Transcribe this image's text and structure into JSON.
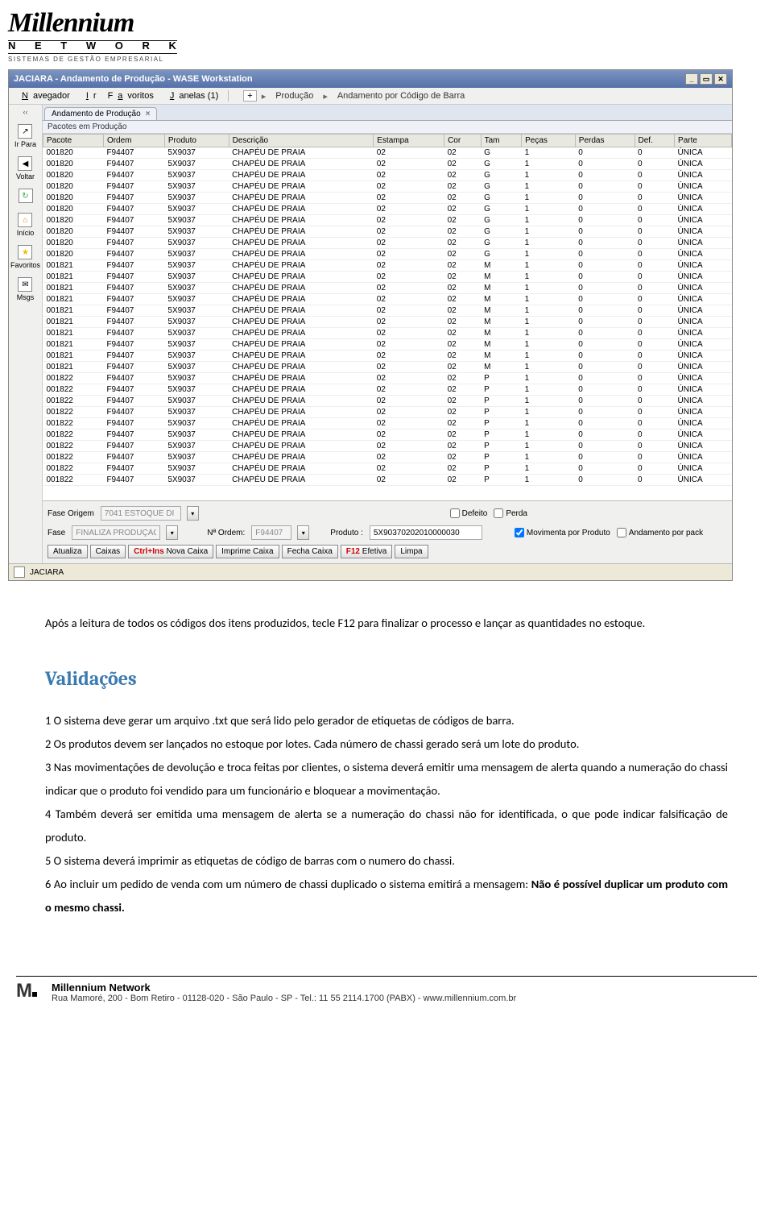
{
  "logo": {
    "main": "Millennium",
    "sub": "N E T W O R K",
    "tag": "SISTEMAS DE GESTÃO EMPRESARIAL"
  },
  "window": {
    "title": "JACIARA - Andamento de Produção - WASE Workstation"
  },
  "menubar": {
    "navegador": "Navegador",
    "ir": "Ir",
    "favoritos": "Favoritos",
    "janelas": "Janelas (1)",
    "plus": "+",
    "crumb1": "Produção",
    "crumb2": "Andamento por Código de Barra"
  },
  "sidebar": {
    "back_arrows": "‹‹",
    "irpara": "Ir Para",
    "voltar": "Voltar",
    "inicio": "Início",
    "favoritos": "Favoritos",
    "msgs": "Msgs"
  },
  "tab": {
    "label": "Andamento de Produção",
    "section": "Pacotes em Produção"
  },
  "columns": [
    "Pacote",
    "Ordem",
    "Produto",
    "Descrição",
    "Estampa",
    "Cor",
    "Tam",
    "Peças",
    "Perdas",
    "Def.",
    "Parte"
  ],
  "rows": [
    [
      "001820",
      "F94407",
      "5X9037",
      "CHAPÉU DE PRAIA",
      "02",
      "02",
      "G",
      "1",
      "0",
      "0",
      "ÚNICA"
    ],
    [
      "001820",
      "F94407",
      "5X9037",
      "CHAPÉU DE PRAIA",
      "02",
      "02",
      "G",
      "1",
      "0",
      "0",
      "ÚNICA"
    ],
    [
      "001820",
      "F94407",
      "5X9037",
      "CHAPÉU DE PRAIA",
      "02",
      "02",
      "G",
      "1",
      "0",
      "0",
      "ÚNICA"
    ],
    [
      "001820",
      "F94407",
      "5X9037",
      "CHAPÉU DE PRAIA",
      "02",
      "02",
      "G",
      "1",
      "0",
      "0",
      "ÚNICA"
    ],
    [
      "001820",
      "F94407",
      "5X9037",
      "CHAPÉU DE PRAIA",
      "02",
      "02",
      "G",
      "1",
      "0",
      "0",
      "ÚNICA"
    ],
    [
      "001820",
      "F94407",
      "5X9037",
      "CHAPÉU DE PRAIA",
      "02",
      "02",
      "G",
      "1",
      "0",
      "0",
      "ÚNICA"
    ],
    [
      "001820",
      "F94407",
      "5X9037",
      "CHAPÉU DE PRAIA",
      "02",
      "02",
      "G",
      "1",
      "0",
      "0",
      "ÚNICA"
    ],
    [
      "001820",
      "F94407",
      "5X9037",
      "CHAPÉU DE PRAIA",
      "02",
      "02",
      "G",
      "1",
      "0",
      "0",
      "ÚNICA"
    ],
    [
      "001820",
      "F94407",
      "5X9037",
      "CHAPÉU DE PRAIA",
      "02",
      "02",
      "G",
      "1",
      "0",
      "0",
      "ÚNICA"
    ],
    [
      "001820",
      "F94407",
      "5X9037",
      "CHAPÉU DE PRAIA",
      "02",
      "02",
      "G",
      "1",
      "0",
      "0",
      "ÚNICA"
    ],
    [
      "001821",
      "F94407",
      "5X9037",
      "CHAPÉU DE PRAIA",
      "02",
      "02",
      "M",
      "1",
      "0",
      "0",
      "ÚNICA"
    ],
    [
      "001821",
      "F94407",
      "5X9037",
      "CHAPÉU DE PRAIA",
      "02",
      "02",
      "M",
      "1",
      "0",
      "0",
      "ÚNICA"
    ],
    [
      "001821",
      "F94407",
      "5X9037",
      "CHAPÉU DE PRAIA",
      "02",
      "02",
      "M",
      "1",
      "0",
      "0",
      "ÚNICA"
    ],
    [
      "001821",
      "F94407",
      "5X9037",
      "CHAPÉU DE PRAIA",
      "02",
      "02",
      "M",
      "1",
      "0",
      "0",
      "ÚNICA"
    ],
    [
      "001821",
      "F94407",
      "5X9037",
      "CHAPÉU DE PRAIA",
      "02",
      "02",
      "M",
      "1",
      "0",
      "0",
      "ÚNICA"
    ],
    [
      "001821",
      "F94407",
      "5X9037",
      "CHAPÉU DE PRAIA",
      "02",
      "02",
      "M",
      "1",
      "0",
      "0",
      "ÚNICA"
    ],
    [
      "001821",
      "F94407",
      "5X9037",
      "CHAPÉU DE PRAIA",
      "02",
      "02",
      "M",
      "1",
      "0",
      "0",
      "ÚNICA"
    ],
    [
      "001821",
      "F94407",
      "5X9037",
      "CHAPÉU DE PRAIA",
      "02",
      "02",
      "M",
      "1",
      "0",
      "0",
      "ÚNICA"
    ],
    [
      "001821",
      "F94407",
      "5X9037",
      "CHAPÉU DE PRAIA",
      "02",
      "02",
      "M",
      "1",
      "0",
      "0",
      "ÚNICA"
    ],
    [
      "001821",
      "F94407",
      "5X9037",
      "CHAPÉU DE PRAIA",
      "02",
      "02",
      "M",
      "1",
      "0",
      "0",
      "ÚNICA"
    ],
    [
      "001822",
      "F94407",
      "5X9037",
      "CHAPÉU DE PRAIA",
      "02",
      "02",
      "P",
      "1",
      "0",
      "0",
      "ÚNICA"
    ],
    [
      "001822",
      "F94407",
      "5X9037",
      "CHAPÉU DE PRAIA",
      "02",
      "02",
      "P",
      "1",
      "0",
      "0",
      "ÚNICA"
    ],
    [
      "001822",
      "F94407",
      "5X9037",
      "CHAPÉU DE PRAIA",
      "02",
      "02",
      "P",
      "1",
      "0",
      "0",
      "ÚNICA"
    ],
    [
      "001822",
      "F94407",
      "5X9037",
      "CHAPÉU DE PRAIA",
      "02",
      "02",
      "P",
      "1",
      "0",
      "0",
      "ÚNICA"
    ],
    [
      "001822",
      "F94407",
      "5X9037",
      "CHAPÉU DE PRAIA",
      "02",
      "02",
      "P",
      "1",
      "0",
      "0",
      "ÚNICA"
    ],
    [
      "001822",
      "F94407",
      "5X9037",
      "CHAPÉU DE PRAIA",
      "02",
      "02",
      "P",
      "1",
      "0",
      "0",
      "ÚNICA"
    ],
    [
      "001822",
      "F94407",
      "5X9037",
      "CHAPÉU DE PRAIA",
      "02",
      "02",
      "P",
      "1",
      "0",
      "0",
      "ÚNICA"
    ],
    [
      "001822",
      "F94407",
      "5X9037",
      "CHAPÉU DE PRAIA",
      "02",
      "02",
      "P",
      "1",
      "0",
      "0",
      "ÚNICA"
    ],
    [
      "001822",
      "F94407",
      "5X9037",
      "CHAPÉU DE PRAIA",
      "02",
      "02",
      "P",
      "1",
      "0",
      "0",
      "ÚNICA"
    ],
    [
      "001822",
      "F94407",
      "5X9037",
      "CHAPÉU DE PRAIA",
      "02",
      "02",
      "P",
      "1",
      "0",
      "0",
      "ÚNICA"
    ]
  ],
  "form": {
    "fase_origem_label": "Fase Origem",
    "fase_origem_value": "7041 ESTOQUE DI",
    "defeito": "Defeito",
    "perda": "Perda",
    "fase_label": "Fase",
    "fase_value": "FINALIZA PRODUÇÃO",
    "ordem_label": "Nª Ordem:",
    "ordem_value": "F94407",
    "produto_label": "Produto :",
    "produto_value": "5X90370202010000030",
    "movimenta": "Movimenta por Produto",
    "andamento_pack": "Andamento por pack"
  },
  "actions": {
    "atualiza": "Atualiza",
    "caixas": "Caixas",
    "ctrlins": "Ctrl+Ins",
    "novacaixa": "Nova Caixa",
    "imprime": "Imprime Caixa",
    "fecha": "Fecha Caixa",
    "f12": "F12",
    "efetiva": "Efetiva",
    "limpa": "Limpa"
  },
  "status": {
    "text": "JACIARA"
  },
  "doc": {
    "p1": "Após a leitura de todos os códigos dos itens produzidos, tecle F12 para finalizar o processo e lançar as quantidades no estoque.",
    "heading": "Validações",
    "p2": "1 O sistema deve gerar um arquivo .txt que será lido pelo gerador de etiquetas de códigos de barra.",
    "p3": "2 Os produtos devem ser lançados no estoque por lotes. Cada número de chassi gerado será um lote do produto.",
    "p4": "3 Nas movimentações de devolução e troca feitas por clientes, o sistema deverá emitir uma mensagem de alerta quando a numeração do chassi indicar que o produto foi vendido para um funcionário e bloquear a movimentação.",
    "p5": "4 Também deverá ser emitida uma mensagem de alerta se a numeração do chassi não for identificada, o que pode indicar falsificação de produto.",
    "p6": "5  O sistema deverá imprimir as etiquetas de código de barras com o numero do chassi.",
    "p7a": "6 Ao incluir um pedido de venda com um número de chassi duplicado o sistema emitirá a mensagem:  ",
    "p7b": "Não é possível duplicar um produto com o mesmo chassi."
  },
  "footer": {
    "brand": "Millennium Network",
    "addr": "Rua Mamoré, 200 - Bom Retiro - 01128-020 - São Paulo - SP - Tel.: 11 55 2114.1700 (PABX) - www.millennium.com.br"
  }
}
